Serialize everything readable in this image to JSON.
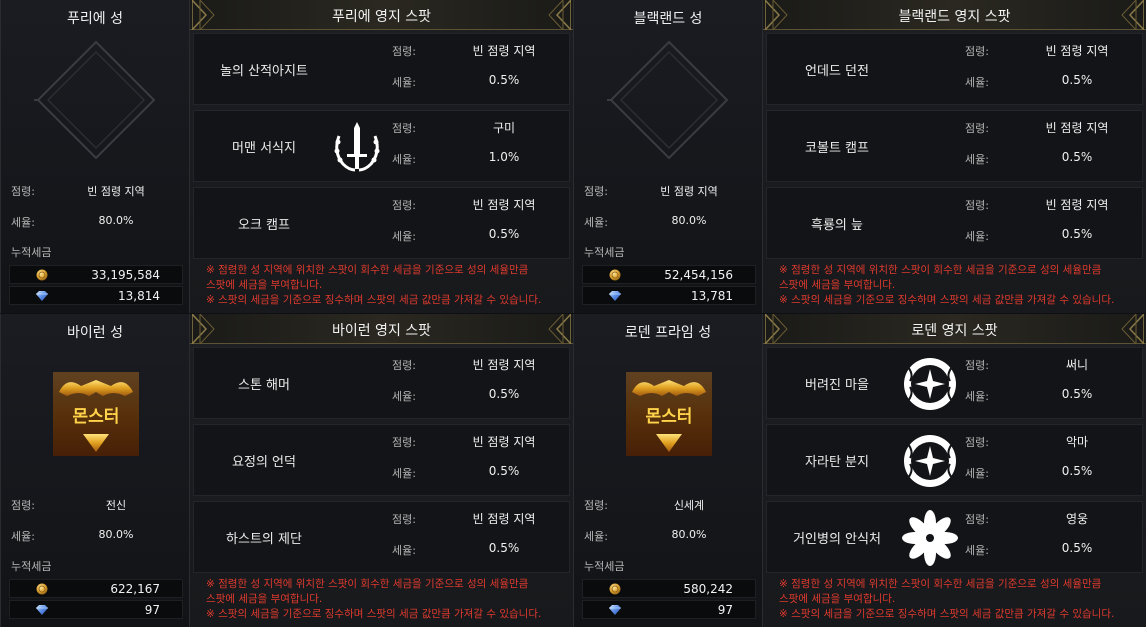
{
  "labels": {
    "occupation": "점령:",
    "tax": "세율:",
    "accumulated": "누적세금"
  },
  "notice": {
    "line1": "※ 점령한 성 지역에 위치한 스팟이 회수한 세금을 기준으로 성의 세율만큼",
    "line2": "스팟에 세금을 부여합니다.",
    "line3": "※ 스팟의 세금을 기준으로 징수하며 스팟의 세금 값만큼 가져갈 수 있습니다."
  },
  "colors": {
    "gold_border": "#5c5234",
    "notice_red": "#e03a2e",
    "adena": "#d9a030",
    "diamond": "#5a8ee8"
  },
  "castles": [
    {
      "name": "푸리에 성",
      "emblem": "empty-diamond-emblem",
      "occupation": "빈 점령 지역",
      "tax": "80.0%",
      "adena": "33,195,584",
      "diamond": "13,814",
      "spot_title": "푸리에 영지 스팟",
      "spots": [
        {
          "name": "놀의 산적아지트",
          "emblem": "",
          "occupation": "빈 점령 지역",
          "tax": "0.5%"
        },
        {
          "name": "머맨 서식지",
          "emblem": "sword-laurel-emblem",
          "occupation": "구미",
          "tax": "1.0%"
        },
        {
          "name": "오크 캠프",
          "emblem": "",
          "occupation": "빈 점령 지역",
          "tax": "0.5%"
        }
      ]
    },
    {
      "name": "블랙랜드 성",
      "emblem": "empty-diamond-emblem",
      "occupation": "빈 점령 지역",
      "tax": "80.0%",
      "adena": "52,454,156",
      "diamond": "13,781",
      "spot_title": "블랙랜드 영지 스팟",
      "spots": [
        {
          "name": "언데드 던전",
          "emblem": "",
          "occupation": "빈 점령 지역",
          "tax": "0.5%"
        },
        {
          "name": "코볼트 캠프",
          "emblem": "",
          "occupation": "빈 점령 지역",
          "tax": "0.5%"
        },
        {
          "name": "흑룡의 늪",
          "emblem": "",
          "occupation": "빈 점령 지역",
          "tax": "0.5%"
        }
      ]
    },
    {
      "name": "바이런 성",
      "emblem": "monster-emblem",
      "emblem_text": "몬스터",
      "occupation": "전신",
      "tax": "80.0%",
      "adena": "622,167",
      "diamond": "97",
      "spot_title": "바이런 영지 스팟",
      "spots": [
        {
          "name": "스톤 해머",
          "emblem": "",
          "occupation": "빈 점령 지역",
          "tax": "0.5%"
        },
        {
          "name": "요정의 언덕",
          "emblem": "",
          "occupation": "빈 점령 지역",
          "tax": "0.5%"
        },
        {
          "name": "하스트의 제단",
          "emblem": "",
          "occupation": "빈 점령 지역",
          "tax": "0.5%"
        }
      ]
    },
    {
      "name": "로덴 프라임 성",
      "emblem": "monster-emblem",
      "emblem_text": "몬스터",
      "occupation": "신세계",
      "tax": "80.0%",
      "adena": "580,242",
      "diamond": "97",
      "spot_title": "로덴 영지 스팟",
      "spots": [
        {
          "name": "버려진 마을",
          "emblem": "compass-star-emblem",
          "occupation": "써니",
          "tax": "0.5%"
        },
        {
          "name": "자라탄 분지",
          "emblem": "compass-star-emblem",
          "occupation": "악마",
          "tax": "0.5%"
        },
        {
          "name": "거인병의 안식처",
          "emblem": "white-flower-emblem",
          "occupation": "영웅",
          "tax": "0.5%"
        }
      ]
    }
  ]
}
